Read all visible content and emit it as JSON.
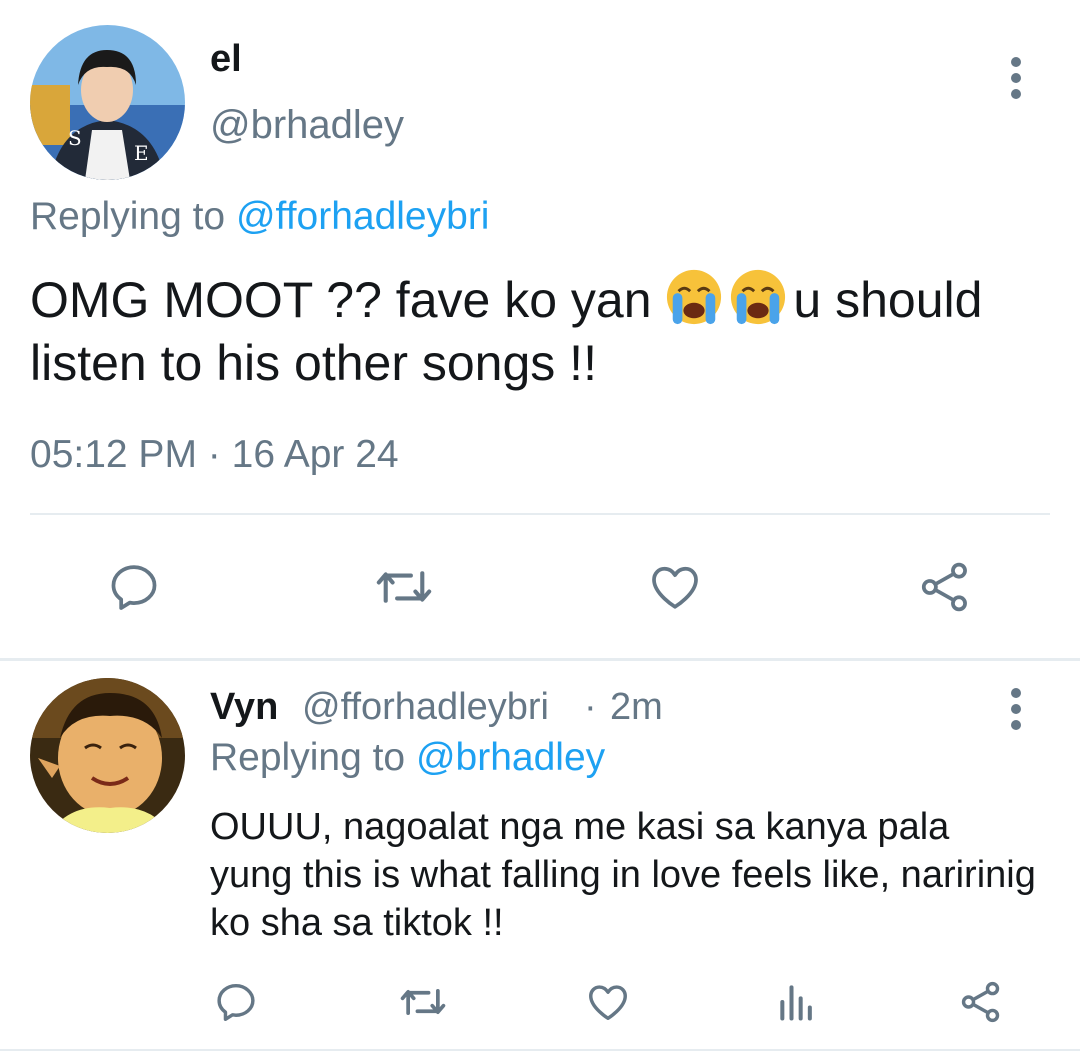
{
  "main_tweet": {
    "display_name": "el",
    "handle": "@brhadley",
    "replying_prefix": "Replying to",
    "replying_to": "@fforhadleybri",
    "text_part1": "OMG MOOT ?? fave ko yan",
    "text_part2": "u should listen to his other songs !!",
    "emoji": "loudly-crying-face",
    "timestamp": "05:12 PM",
    "separator": "·",
    "date": "16 Apr 24",
    "avatar_icon": "user-avatar",
    "actions": [
      "reply-icon",
      "retweet-icon",
      "like-icon",
      "share-icon"
    ]
  },
  "reply_tweet": {
    "display_name": "Vyn",
    "handle": "@fforhadleybri",
    "separator": "·",
    "time_ago": "2m",
    "replying_prefix": "Replying to",
    "replying_to": "@brhadley",
    "text": "OUUU, nagoalat nga me kasi sa kanya pala yung this is what falling in love feels like, naririnig ko sha sa tiktok !!",
    "avatar_icon": "user-avatar",
    "actions": [
      "reply-icon",
      "retweet-icon",
      "like-icon",
      "analytics-icon",
      "share-icon"
    ]
  },
  "colors": {
    "link": "#1da1f2",
    "secondary_text": "#657786",
    "primary_text": "#14171a",
    "divider": "#e6ecf0"
  }
}
